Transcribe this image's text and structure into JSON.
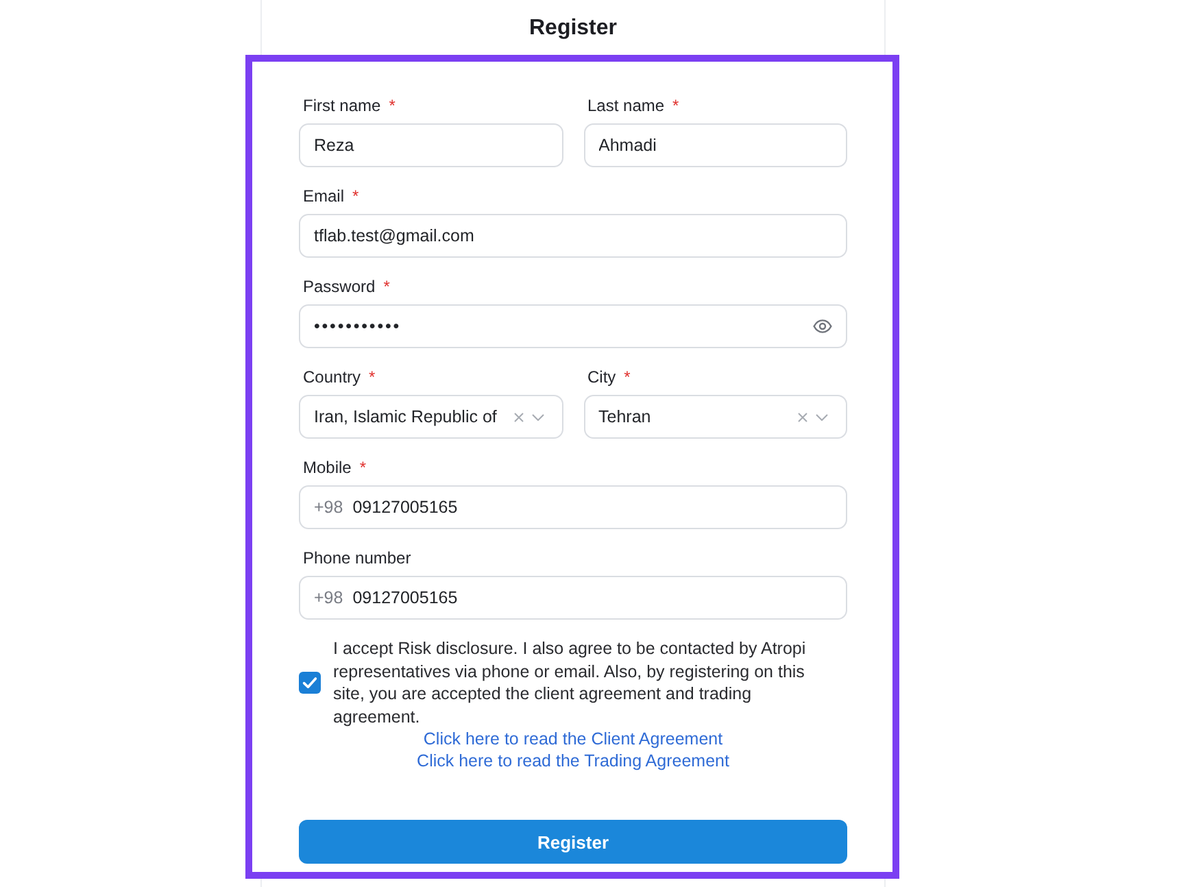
{
  "page": {
    "title": "Register"
  },
  "form": {
    "rows": [
      {
        "fields": [
          {
            "kind": "text",
            "label": "First name",
            "required_mark": "*",
            "value": "Reza"
          },
          {
            "kind": "text",
            "label": "Last name",
            "required_mark": "*",
            "value": "Ahmadi"
          }
        ]
      },
      {
        "fields": [
          {
            "kind": "text",
            "label": "Email",
            "required_mark": "*",
            "value": "tflab.test@gmail.com"
          }
        ]
      },
      {
        "fields": [
          {
            "kind": "password",
            "label": "Password",
            "required_mark": "*",
            "value": "•••••••••••"
          }
        ]
      },
      {
        "fields": [
          {
            "kind": "select",
            "label": "Country",
            "required_mark": "*",
            "value": "Iran, Islamic Republic of"
          },
          {
            "kind": "select",
            "label": "City",
            "required_mark": "*",
            "value": "Tehran"
          }
        ]
      },
      {
        "fields": [
          {
            "kind": "phone",
            "label": "Mobile",
            "required_mark": "*",
            "dial_code": "+98",
            "value": "09127005165"
          }
        ]
      },
      {
        "fields": [
          {
            "kind": "phone",
            "label": "Phone number",
            "dial_code": "+98",
            "value": "09127005165"
          }
        ]
      }
    ]
  },
  "consent": {
    "checked": true,
    "text": "I accept Risk disclosure. I also agree to be contacted by Atropi representatives via phone or email. Also, by registering on this site, you are accepted the client agreement and trading agreement.",
    "links": [
      "Click here to read the Client Agreement",
      "Click here to read the Trading Agreement"
    ]
  },
  "submit_button": {
    "label": "Register"
  }
}
